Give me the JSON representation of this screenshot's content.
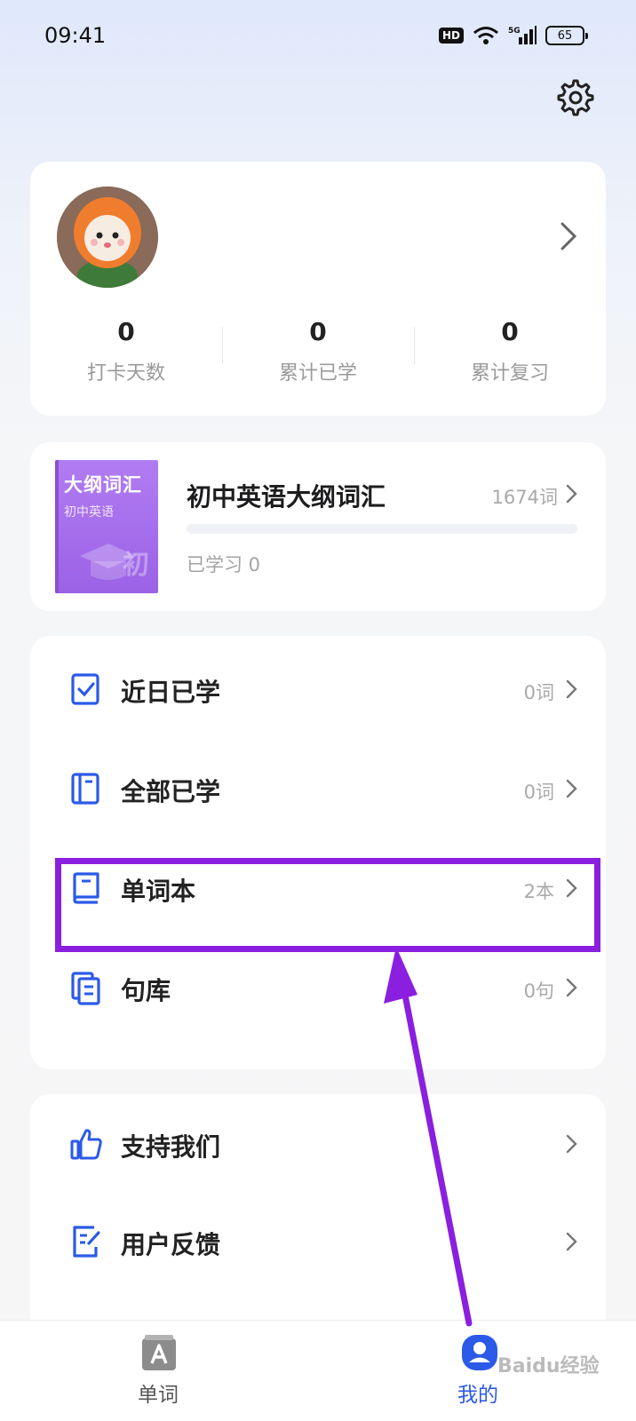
{
  "status_bar": {
    "time": "09:41",
    "battery": "65",
    "signal_label": "5G",
    "hd_label": "HD"
  },
  "profile": {
    "stats": [
      {
        "value": "0",
        "label": "打卡天数"
      },
      {
        "value": "0",
        "label": "累计已学"
      },
      {
        "value": "0",
        "label": "累计复习"
      }
    ]
  },
  "book": {
    "cover_title": "大纲词汇",
    "cover_subtitle": "初中英语",
    "cover_glyph": "初",
    "title": "初中英语大纲词汇",
    "count": "1674词",
    "learned": "已学习 0",
    "progress": 0
  },
  "menu": [
    {
      "label": "近日已学",
      "count": "0词",
      "icon": "check-doc-icon"
    },
    {
      "label": "全部已学",
      "count": "0词",
      "icon": "notebook-icon"
    },
    {
      "label": "单词本",
      "count": "2本",
      "icon": "book-icon"
    },
    {
      "label": "句库",
      "count": "0句",
      "icon": "copy-docs-icon"
    }
  ],
  "menu2": [
    {
      "label": "支持我们",
      "icon": "thumbs-up-icon"
    },
    {
      "label": "用户反馈",
      "icon": "feedback-edit-icon"
    }
  ],
  "tabs": [
    {
      "label": "单词",
      "icon": "word-a-icon"
    },
    {
      "label": "我的",
      "icon": "profile-icon"
    }
  ],
  "watermark": "Baidu经验",
  "colors": {
    "accent": "#2b5ae8",
    "highlight": "#8a1fe0",
    "cover": "#a46dec"
  }
}
